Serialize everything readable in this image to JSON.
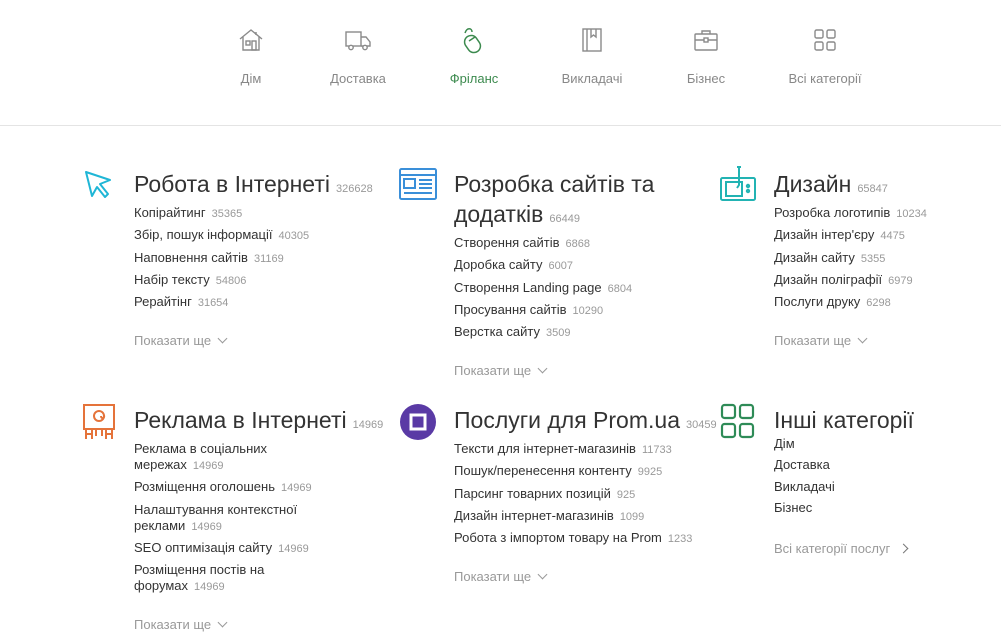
{
  "nav": {
    "items": [
      {
        "label": "Дім",
        "icon": "house-icon"
      },
      {
        "label": "Доставка",
        "icon": "truck-icon"
      },
      {
        "label": "Фріланс",
        "icon": "mouse-icon",
        "active": true
      },
      {
        "label": "Викладачі",
        "icon": "book-icon"
      },
      {
        "label": "Бізнес",
        "icon": "briefcase-icon"
      },
      {
        "label": "Всі категорії",
        "icon": "grid-icon"
      }
    ],
    "active_color": "#3c8a4e",
    "inactive_color": "#888888"
  },
  "sections": [
    {
      "title": "Робота в Інтернеті",
      "count": "326628",
      "icon": "cursor-icon",
      "icon_color": "#1fb6d6",
      "links": [
        {
          "label": "Копірайтинг",
          "count": "35365"
        },
        {
          "label": "Збір, пошук інформації",
          "count": "40305"
        },
        {
          "label": "Наповнення сайтів",
          "count": "31169"
        },
        {
          "label": "Набір тексту",
          "count": "54806"
        },
        {
          "label": "Рерайтінг",
          "count": "31654"
        }
      ],
      "show_more": "Показати ще"
    },
    {
      "title": "Розробка сайтів та додатків",
      "count": "66449",
      "icon": "browser-window-icon",
      "icon_color": "#3a8fd9",
      "links": [
        {
          "label": "Створення сайтів",
          "count": "6868"
        },
        {
          "label": "Доробка сайту",
          "count": "6007"
        },
        {
          "label": "Створення Landing page",
          "count": "6804"
        },
        {
          "label": "Просування сайтів",
          "count": "10290"
        },
        {
          "label": "Верстка сайту",
          "count": "3509"
        }
      ],
      "show_more": "Показати ще"
    },
    {
      "title": "Дизайн",
      "count": "65847",
      "icon": "graphics-tablet-icon",
      "icon_color": "#22b3b3",
      "links": [
        {
          "label": "Розробка логотипів",
          "count": "10234"
        },
        {
          "label": "Дизайн інтер'єру",
          "count": "4475"
        },
        {
          "label": "Дизайн сайту",
          "count": "5355"
        },
        {
          "label": "Дизайн поліграфії",
          "count": "6979"
        },
        {
          "label": "Послуги друку",
          "count": "6298"
        }
      ],
      "show_more": "Показати ще"
    },
    {
      "title": "Реклама в Інтернеті",
      "count": "14969",
      "icon": "ad-sign-icon",
      "icon_color": "#e5733a",
      "links": [
        {
          "label": "Реклама в соціальних мережах",
          "count": "14969"
        },
        {
          "label": "Розміщення оголошень",
          "count": "14969"
        },
        {
          "label": "Налаштування контекстної реклами",
          "count": "14969"
        },
        {
          "label": "SEO оптимізація сайту",
          "count": "14969"
        },
        {
          "label": "Розміщення постів на форумах",
          "count": "14969"
        }
      ],
      "show_more": "Показати ще"
    },
    {
      "title": "Послуги для Prom.ua",
      "count": "30459",
      "icon": "prom-logo-icon",
      "icon_color": "#5a3aa5",
      "links": [
        {
          "label": "Тексти для інтернет-магазинів",
          "count": "11733"
        },
        {
          "label": "Пошук/перенесення контенту",
          "count": "9925"
        },
        {
          "label": "Парсинг товарних позицій",
          "count": "925"
        },
        {
          "label": "Дизайн інтернет-магазинів",
          "count": "1099"
        },
        {
          "label": "Робота з імпортом товару на Prom",
          "count": "1233"
        }
      ],
      "show_more": "Показати ще"
    },
    {
      "title": "Інші категорії",
      "icon": "grid-icon",
      "icon_color": "#2e8b57",
      "links": [
        {
          "label": "Дім"
        },
        {
          "label": "Доставка"
        },
        {
          "label": "Викладачі"
        },
        {
          "label": "Бізнес"
        }
      ],
      "all_categories": "Всі категорії послуг"
    }
  ]
}
